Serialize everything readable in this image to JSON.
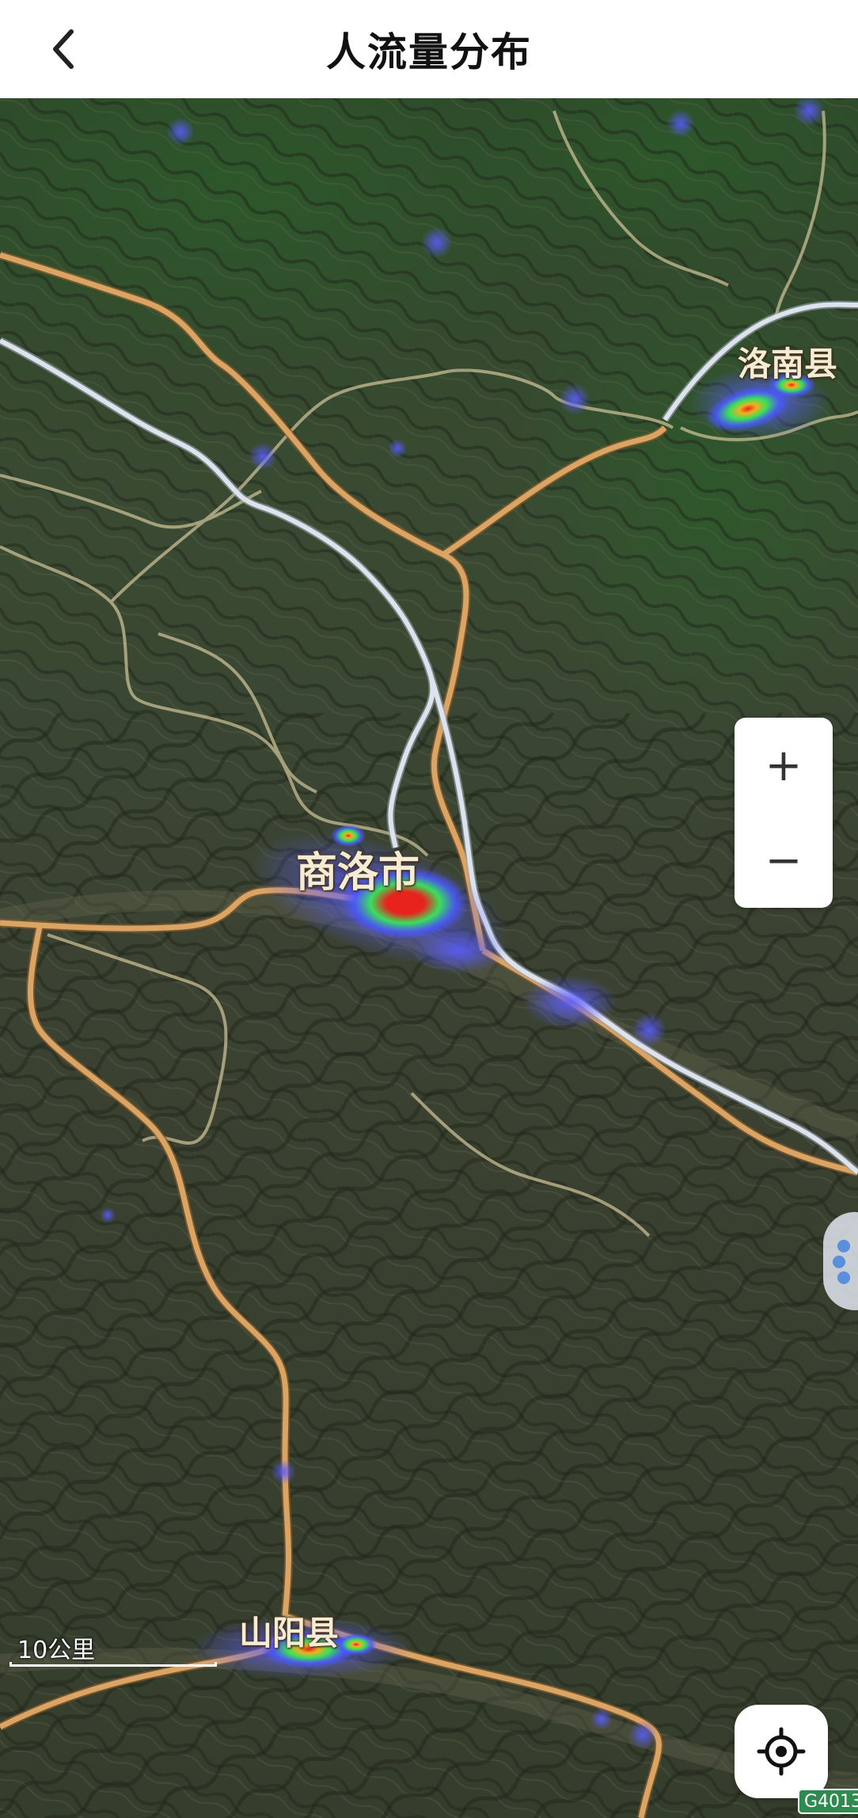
{
  "header": {
    "title": "人流量分布",
    "back_icon": "chevron-left-icon"
  },
  "map": {
    "type": "satellite heatmap",
    "places": [
      {
        "name": "商洛市",
        "heat_level": "high"
      },
      {
        "name": "洛南县",
        "heat_level": "medium"
      },
      {
        "name": "山阳县",
        "heat_level": "medium"
      }
    ],
    "scale_label": "10公里",
    "road_shield": "G4013",
    "colors": {
      "road_major": "#d9a464",
      "road_expressway": "#dde3ec",
      "road_minor": "#c9bf95",
      "heat_low": "#4a58ff",
      "heat_mid": "#39e05a",
      "heat_high": "#e8231e"
    }
  },
  "controls": {
    "zoom_in": "+",
    "zoom_out": "−",
    "locate_icon": "crosshair-locate-icon",
    "side_handle_icon": "paw-icon"
  }
}
